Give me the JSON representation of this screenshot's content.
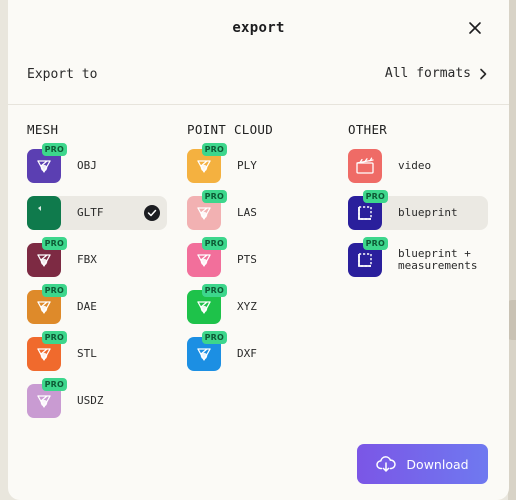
{
  "modal": {
    "title": "export"
  },
  "export_row": {
    "label": "Export to",
    "all_formats": "All formats"
  },
  "columns": [
    {
      "heading": "MESH",
      "items": [
        {
          "label": "OBJ",
          "pro": "PRO",
          "color": "#5b3fb2",
          "icon": "obj-format-icon"
        },
        {
          "label": "GLTF",
          "pro": "",
          "color": "#0f7a4c",
          "icon": "gltf-format-icon",
          "selected": true
        },
        {
          "label": "FBX",
          "pro": "PRO",
          "color": "#7d2a43",
          "icon": "fbx-format-icon"
        },
        {
          "label": "DAE",
          "pro": "PRO",
          "color": "#de8a2a",
          "icon": "dae-format-icon"
        },
        {
          "label": "STL",
          "pro": "PRO",
          "color": "#f06a2d",
          "icon": "stl-format-icon"
        },
        {
          "label": "USDZ",
          "pro": "PRO",
          "color": "#c99bd2",
          "icon": "usdz-format-icon"
        }
      ]
    },
    {
      "heading": "POINT CLOUD",
      "items": [
        {
          "label": "PLY",
          "pro": "PRO",
          "color": "#f4b140",
          "icon": "ply-format-icon"
        },
        {
          "label": "LAS",
          "pro": "PRO",
          "color": "#f2b1b2",
          "icon": "las-format-icon"
        },
        {
          "label": "PTS",
          "pro": "PRO",
          "color": "#f26f9b",
          "icon": "pts-format-icon"
        },
        {
          "label": "XYZ",
          "pro": "PRO",
          "color": "#1ec24a",
          "icon": "xyz-format-icon"
        },
        {
          "label": "DXF",
          "pro": "PRO",
          "color": "#1c8fe3",
          "icon": "dxf-format-icon"
        }
      ]
    },
    {
      "heading": "OTHER",
      "items": [
        {
          "label": "video",
          "pro": "",
          "color": "#ef6b66",
          "icon": "video-clapper-icon"
        },
        {
          "label": "blueprint",
          "pro": "PRO",
          "color": "#2a1f9c",
          "icon": "blueprint-icon",
          "selected": true
        },
        {
          "label": "blueprint +\nmeasurements",
          "pro": "PRO",
          "color": "#2a1f9c",
          "icon": "blueprint-measure-icon"
        }
      ]
    }
  ],
  "footer": {
    "download_label": "Download"
  },
  "colors": {
    "accent_start": "#7b56e6",
    "accent_end": "#6f79f0",
    "pro_badge": "#3dd68c"
  }
}
